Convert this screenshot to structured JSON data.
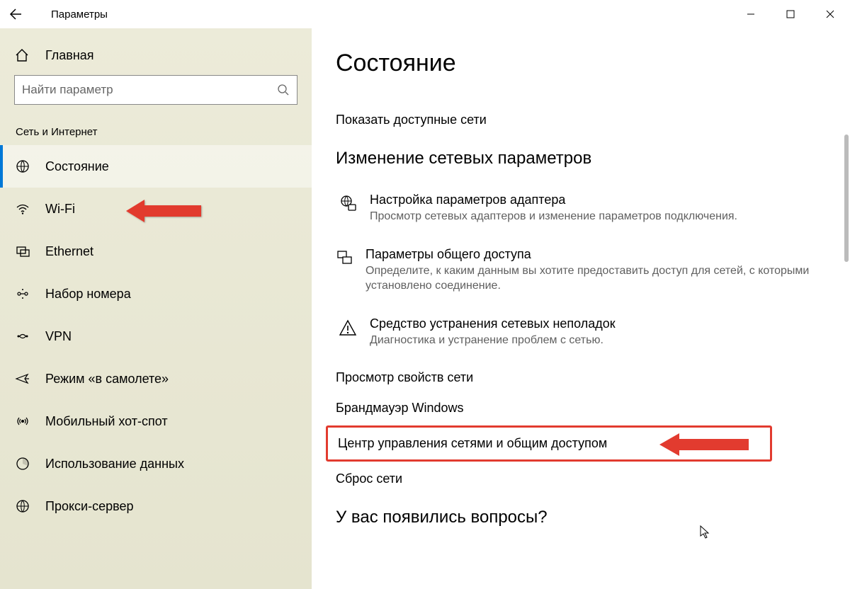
{
  "window": {
    "title": "Параметры"
  },
  "home": {
    "label": "Главная"
  },
  "search": {
    "placeholder": "Найти параметр"
  },
  "section": {
    "label": "Сеть и Интернет"
  },
  "nav": [
    {
      "label": "Состояние",
      "icon": "status-icon",
      "selected": true
    },
    {
      "label": "Wi-Fi",
      "icon": "wifi-icon",
      "selected": false
    },
    {
      "label": "Ethernet",
      "icon": "ethernet-icon",
      "selected": false
    },
    {
      "label": "Набор номера",
      "icon": "dialup-icon",
      "selected": false
    },
    {
      "label": "VPN",
      "icon": "vpn-icon",
      "selected": false
    },
    {
      "label": "Режим «в самолете»",
      "icon": "airplane-icon",
      "selected": false
    },
    {
      "label": "Мобильный хот-спот",
      "icon": "hotspot-icon",
      "selected": false
    },
    {
      "label": "Использование данных",
      "icon": "datausage-icon",
      "selected": false
    },
    {
      "label": "Прокси-сервер",
      "icon": "proxy-icon",
      "selected": false
    }
  ],
  "page": {
    "title": "Состояние",
    "show_networks": "Показать доступные сети",
    "change_heading": "Изменение сетевых параметров",
    "adapter": {
      "title": "Настройка параметров адаптера",
      "desc": "Просмотр сетевых адаптеров и изменение параметров подключения."
    },
    "sharing": {
      "title": "Параметры общего доступа",
      "desc": "Определите, к каким данным вы хотите предоставить доступ для сетей, с которыми установлено соединение."
    },
    "trouble": {
      "title": "Средство устранения сетевых неполадок",
      "desc": "Диагностика и устранение проблем с сетью."
    },
    "view_props": "Просмотр свойств сети",
    "firewall": "Брандмауэр Windows",
    "sharing_center": "Центр управления сетями и общим доступом",
    "reset": "Сброс сети",
    "questions": "У вас появились вопросы?"
  }
}
